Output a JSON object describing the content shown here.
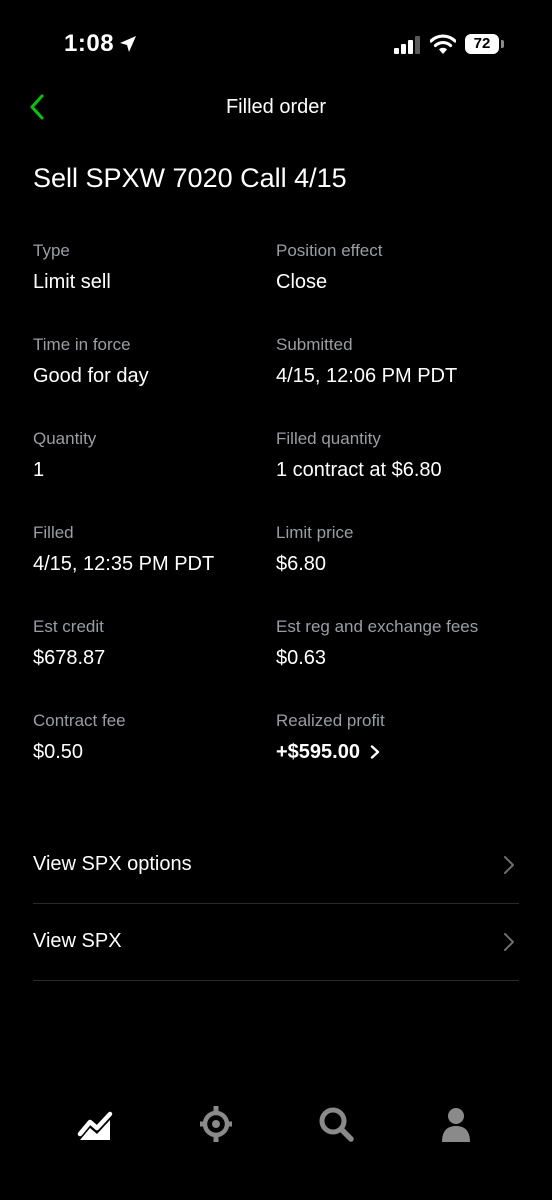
{
  "status_bar": {
    "time": "1:08",
    "battery": "72"
  },
  "header": {
    "title": "Filled order"
  },
  "order": {
    "title": "Sell SPXW 7020 Call 4/15"
  },
  "details": {
    "type_label": "Type",
    "type_value": "Limit sell",
    "position_effect_label": "Position effect",
    "position_effect_value": "Close",
    "time_in_force_label": "Time in force",
    "time_in_force_value": "Good for day",
    "submitted_label": "Submitted",
    "submitted_value": "4/15, 12:06 PM PDT",
    "quantity_label": "Quantity",
    "quantity_value": "1",
    "filled_quantity_label": "Filled quantity",
    "filled_quantity_value": "1 contract at $6.80",
    "filled_label": "Filled",
    "filled_value": "4/15, 12:35 PM PDT",
    "limit_price_label": "Limit price",
    "limit_price_value": "$6.80",
    "est_credit_label": "Est credit",
    "est_credit_value": "$678.87",
    "est_fees_label": "Est reg and exchange fees",
    "est_fees_value": "$0.63",
    "contract_fee_label": "Contract fee",
    "contract_fee_value": "$0.50",
    "realized_profit_label": "Realized profit",
    "realized_profit_value": "+$595.00"
  },
  "links": {
    "view_options": "View SPX options",
    "view_spx": "View SPX"
  },
  "tabs": [
    "investing-chart-icon",
    "crypto-icon",
    "search-icon",
    "account-icon"
  ],
  "colors": {
    "accent": "#00c805",
    "background": "#000000",
    "secondary_text": "#9a9ea3"
  }
}
